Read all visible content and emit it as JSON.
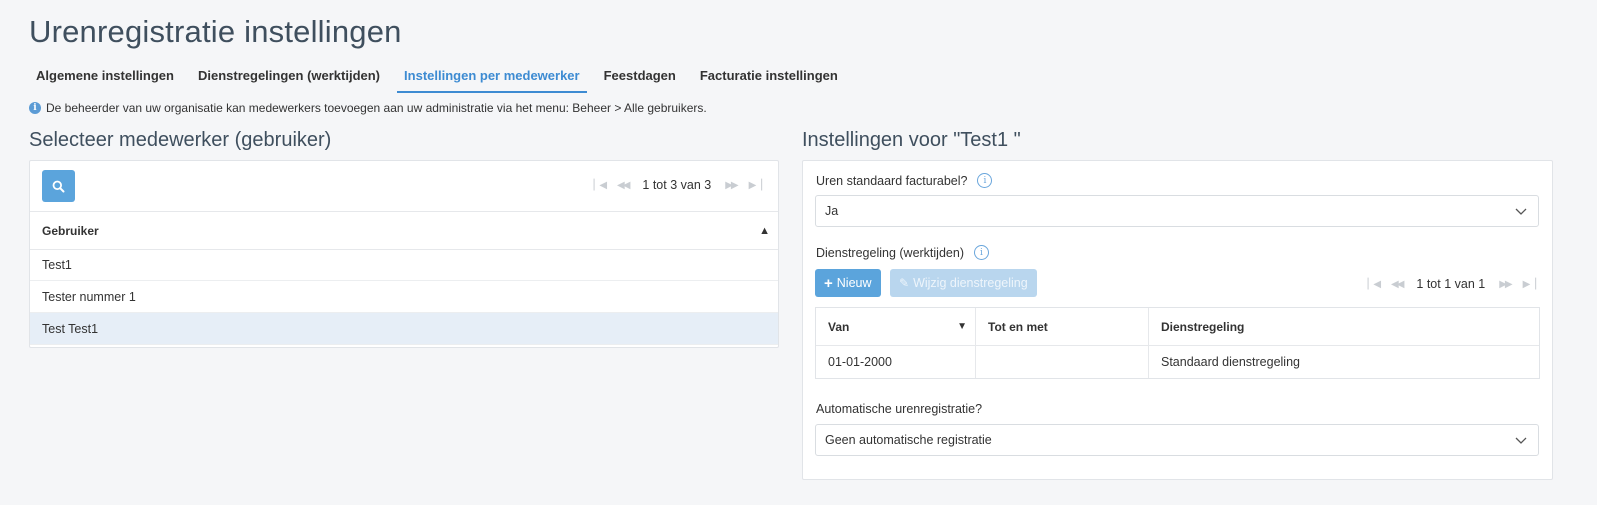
{
  "page": {
    "title": "Urenregistratie instellingen"
  },
  "tabs": [
    {
      "label": "Algemene instellingen"
    },
    {
      "label": "Dienstregelingen (werktijden)"
    },
    {
      "label": "Instellingen per medewerker"
    },
    {
      "label": "Feestdagen"
    },
    {
      "label": "Facturatie instellingen"
    }
  ],
  "info": {
    "text": "De beheerder van uw organisatie kan medewerkers toevoegen aan uw administratie via het menu: Beheer > Alle gebruikers."
  },
  "left": {
    "title": "Selecteer medewerker (gebruiker)",
    "pager": "1 tot 3 van 3",
    "column": "Gebruiker",
    "sort_glyph": "▲",
    "rows": [
      {
        "name": "Test1"
      },
      {
        "name": "Tester nummer 1"
      },
      {
        "name": "Test Test1"
      }
    ]
  },
  "right": {
    "title": "Instellingen voor \"Test1 \"",
    "billable_label": "Uren standaard facturabel?",
    "billable_value": "Ja",
    "schedule_label": "Dienstregeling (werktijden)",
    "new_button": "Nieuw",
    "edit_button": "Wijzig dienstregeling",
    "pager": "1 tot 1 van 1",
    "columns": {
      "van": "Van",
      "tot": "Tot en met",
      "dienst": "Dienstregeling"
    },
    "sort_glyph": "▼",
    "schedule_rows": [
      {
        "van": "01-01-2000",
        "tot": "",
        "dienst": "Standaard dienstregeling"
      }
    ],
    "auto_label": "Automatische urenregistratie?",
    "auto_value": "Geen automatische registratie"
  },
  "colors": {
    "accent": "#3d8bd2",
    "button": "#5ba4dc",
    "selected_row": "#e6eef7"
  }
}
